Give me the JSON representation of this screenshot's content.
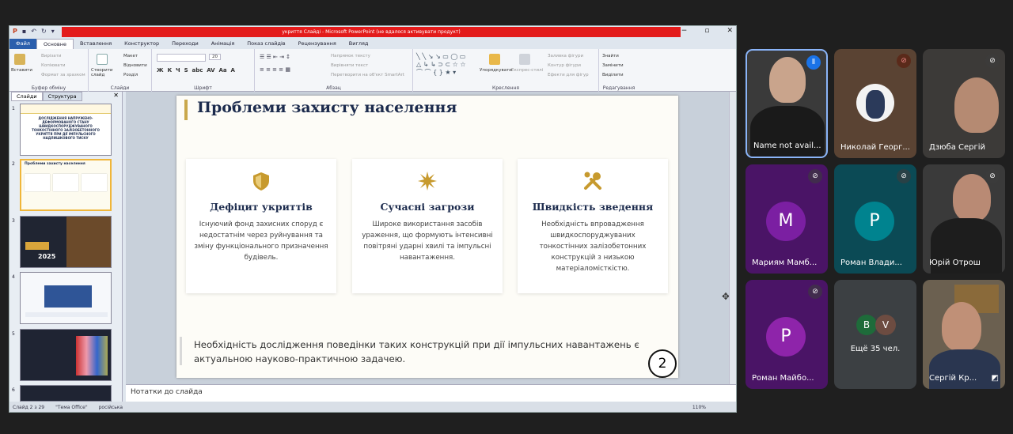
{
  "app": {
    "window_title": "укриття Слайді - Microsoft PowerPoint (не вдалося активувати продукт)"
  },
  "tabs": [
    "Файл",
    "Основне",
    "Вставлення",
    "Конструктор",
    "Переходи",
    "Анімація",
    "Показ слайдів",
    "Рецензування",
    "Вигляд"
  ],
  "ribbon": {
    "clipboard": {
      "paste": "Вставити",
      "cut": "Вирізати",
      "copy": "Копіювати",
      "format": "Формат за зразком",
      "label": "Буфер обміну"
    },
    "slides": {
      "new": "Створити слайд",
      "layout": "Макет",
      "reset": "Відновити",
      "section": "Розділ",
      "label": "Слайди"
    },
    "font": {
      "size": "20",
      "label": "Шрифт"
    },
    "paragraph": {
      "direction": "Напрямок тексту",
      "align": "Вирівняти текст",
      "smartart": "Перетворити на об'єкт SmartArt",
      "label": "Абзац"
    },
    "drawing": {
      "arrange": "Упорядкувати",
      "quickstyles": "Експрес-стилі",
      "fill": "Заливка фігури",
      "outline": "Контур фігури",
      "effects": "Ефекти для фігур",
      "label": "Креслення"
    },
    "editing": {
      "find": "Знайти",
      "replace": "Замінити",
      "select": "Виділити",
      "label": "Редагування"
    }
  },
  "panel": {
    "tab_slides": "Слайди",
    "tab_outline": "Структура",
    "thumb1_title": "ДОСЛІДЖЕННЯ НАПРУЖЕНО-ДЕФОРМОВАНОГО СТАНУ ШВИДКОСПОРУДЖУВАНОГО ТОНКОСТІННОГО ЗАЛІЗОБЕТОННОГО УКРИТТЯ ПРИ ДІЇ ІМПУЛЬСНОГО НАДЛИШКОВОГО ТИСКУ",
    "thumb2_title": "Проблеми захисту населення",
    "thumb3_year": "2025"
  },
  "slide": {
    "title": "Проблеми захисту населення",
    "cards": [
      {
        "title": "Дефіцит укриттів",
        "body": "Існуючий фонд захисних споруд є недостатнім через руйнування та зміну функціонального призначення будівель."
      },
      {
        "title": "Сучасні загрози",
        "body": "Широке використання засобів ураження, що формують інтенсивні повітряні ударні хвилі та імпульсні навантаження."
      },
      {
        "title": "Швидкість зведення",
        "body": "Необхідність впровадження швидкоспоруджуваних тонкостінних залізобетонних конструкцій з низькою матеріаломісткістю."
      }
    ],
    "footer": "Необхідність дослідження поведінки таких конструкцій при дії імпульсних навантажень є актуальною науково-практичною задачею.",
    "page_circle": "2"
  },
  "notes_placeholder": "Нотатки до слайда",
  "status": {
    "slide": "Слайд 2 з 29",
    "theme": "\"Тема Office\"",
    "lang": "російська",
    "zoom": "110%"
  },
  "participants": [
    {
      "name": "Name not avail...",
      "color": "#3a3a3a"
    },
    {
      "name": "Николай Георг...",
      "color": "#5a4333"
    },
    {
      "name": "Дзюба Сергій",
      "color": "#3c3a38"
    },
    {
      "name": "Мариям Мамб...",
      "initial": "М",
      "avatar_color": "#7b1fa2",
      "color": "#4a1466"
    },
    {
      "name": "Роман Влади...",
      "initial": "P",
      "avatar_color": "#00838f",
      "color": "#0b4a55"
    },
    {
      "name": "Юрій Отрош",
      "color": "#3a3a3a"
    },
    {
      "name": "Роман Майбо...",
      "initial": "P",
      "avatar_color": "#8e24aa",
      "color": "#4a1466"
    },
    {
      "name": "Ещё 35 чел.",
      "initials": [
        "B",
        "V"
      ],
      "color": "#3c4043"
    },
    {
      "name": "Сергій Кр...",
      "color": "#6b6050"
    }
  ]
}
